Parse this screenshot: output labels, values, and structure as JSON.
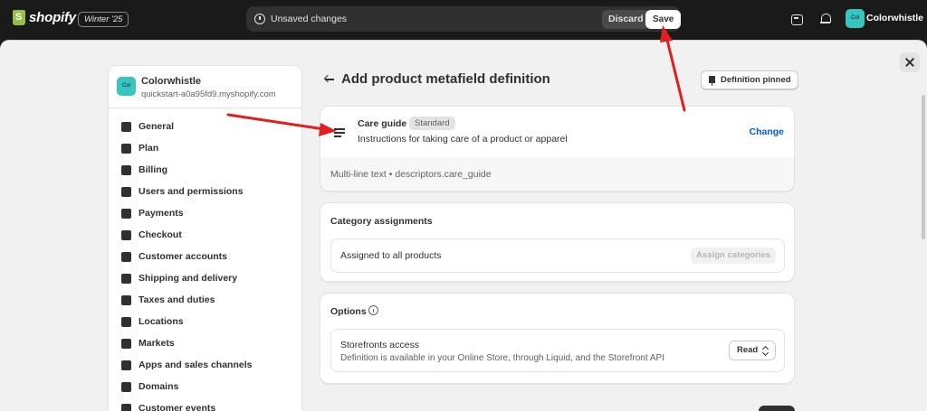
{
  "topbar": {
    "logo_text": "shopify",
    "edition": "Winter '25",
    "unsaved_text": "Unsaved changes",
    "discard_label": "Discard",
    "save_label": "Save",
    "store_avatar": "Col",
    "store_name": "Colorwhistle"
  },
  "sidebar": {
    "store_avatar": "Col",
    "store_name": "Colorwhistle",
    "store_url": "quickstart-a0a95fd9.myshopify.com",
    "items": [
      {
        "label": "General",
        "icon": "store-icon"
      },
      {
        "label": "Plan",
        "icon": "plan-icon"
      },
      {
        "label": "Billing",
        "icon": "billing-icon"
      },
      {
        "label": "Users and permissions",
        "icon": "users-icon"
      },
      {
        "label": "Payments",
        "icon": "payments-icon"
      },
      {
        "label": "Checkout",
        "icon": "cart-icon"
      },
      {
        "label": "Customer accounts",
        "icon": "person-icon"
      },
      {
        "label": "Shipping and delivery",
        "icon": "truck-icon"
      },
      {
        "label": "Taxes and duties",
        "icon": "tax-icon"
      },
      {
        "label": "Locations",
        "icon": "location-icon"
      },
      {
        "label": "Markets",
        "icon": "globe-icon"
      },
      {
        "label": "Apps and sales channels",
        "icon": "apps-icon"
      },
      {
        "label": "Domains",
        "icon": "globe-icon"
      },
      {
        "label": "Customer events",
        "icon": "events-icon"
      }
    ]
  },
  "main": {
    "title": "Add product metafield definition",
    "pin_label": "Definition pinned",
    "definition": {
      "name": "Care guide",
      "badge": "Standard",
      "description": "Instructions for taking care of a product or apparel",
      "change_label": "Change",
      "footer": "Multi-line text • descriptors.care_guide"
    },
    "category": {
      "title": "Category assignments",
      "assigned_text": "Assigned to all products",
      "assign_button": "Assign categories"
    },
    "options": {
      "title": "Options",
      "storefront_title": "Storefronts access",
      "storefront_desc": "Definition is available in your Online Store, through Liquid, and the Storefront API",
      "access_value": "Read"
    }
  },
  "colors": {
    "accent_link": "#005bd3",
    "avatar": "#36c5c0",
    "annotation_arrow": "#e02020"
  }
}
